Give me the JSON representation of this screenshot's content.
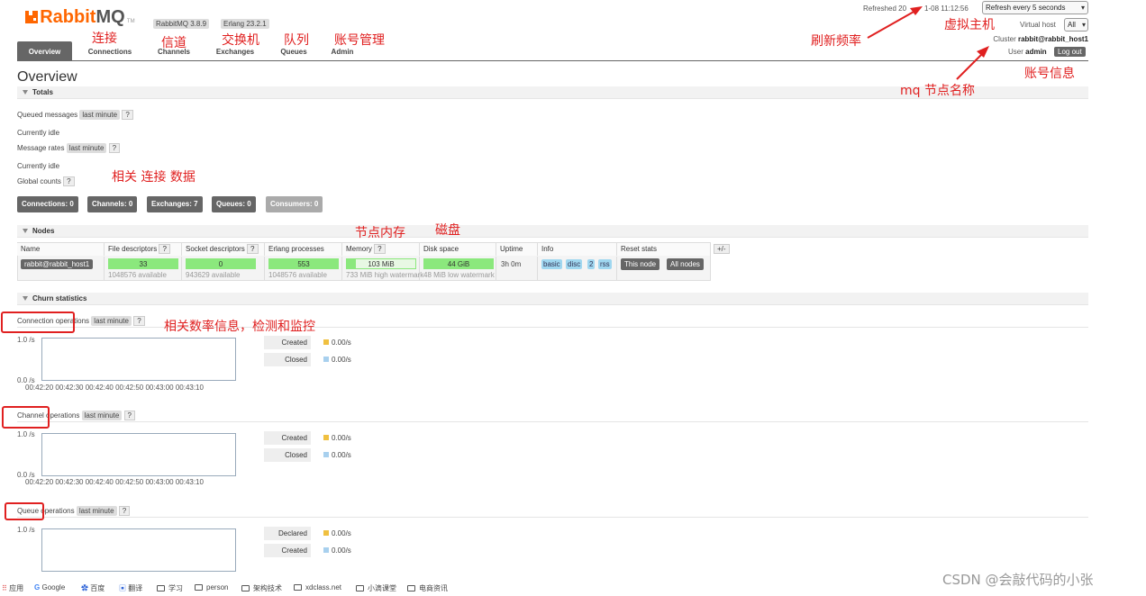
{
  "header": {
    "logo_prefix": "Rabbit",
    "logo_suffix": "MQ",
    "logo_tm": "TM",
    "version_badge": "RabbitMQ 3.8.9",
    "erlang_badge": "Erlang 23.2.1",
    "refreshed_label": "Refreshed 20",
    "refreshed_time": "1-08 11:12:56",
    "refresh_select": "Refresh every 5 seconds",
    "vhost_label": "Virtual host",
    "vhost_select": "All",
    "cluster_label": "Cluster",
    "cluster_name": "rabbit@rabbit_host1",
    "user_label": "User",
    "user_name": "admin",
    "logout_label": "Log out"
  },
  "tabs": [
    {
      "label": "Overview",
      "active": true
    },
    {
      "label": "Connections"
    },
    {
      "label": "Channels"
    },
    {
      "label": "Exchanges"
    },
    {
      "label": "Queues"
    },
    {
      "label": "Admin"
    }
  ],
  "page_title": "Overview",
  "totals": {
    "section_title": "Totals",
    "queued_label": "Queued messages",
    "queued_badge": "last minute",
    "help": "?",
    "idle1": "Currently idle",
    "rates_label": "Message rates",
    "rates_badge": "last minute",
    "idle2": "Currently idle",
    "global_label": "Global counts",
    "connections_btn": "Connections: 0",
    "channels_btn": "Channels: 0",
    "exchanges_btn": "Exchanges: 7",
    "queues_btn": "Queues: 0",
    "consumers_btn": "Consumers: 0"
  },
  "nodes": {
    "section_title": "Nodes",
    "headers": [
      "Name",
      "File descriptors",
      "Socket descriptors",
      "Erlang processes",
      "Memory",
      "Disk space",
      "Uptime",
      "Info",
      "Reset stats"
    ],
    "plus_minus": "+/-",
    "row": {
      "name": "rabbit@rabbit_host1",
      "fd_value": "33",
      "fd_avail": "1048576 available",
      "sd_value": "0",
      "sd_avail": "943629 available",
      "ep_value": "553",
      "ep_avail": "1048576 available",
      "mem_value": "103 MiB",
      "mem_sub": "733 MiB high watermark",
      "disk_value": "44 GiB",
      "disk_sub": "48 MiB low watermark",
      "uptime": "3h 0m",
      "info_tags": [
        "basic",
        "disc",
        "2",
        "rss"
      ],
      "reset_this": "This node",
      "reset_all": "All nodes"
    }
  },
  "churn": {
    "section_title": "Churn statistics",
    "help": "?",
    "badge": "last minute",
    "y_top": "1.0 /s",
    "y_bottom": "0.0 /s",
    "x_ticks": "00:42:20 00:42:30 00:42:40 00:42:50 00:43:00 00:43:10",
    "connection_label": "Connection operations",
    "connection_legend": [
      {
        "name": "Created",
        "value": "0.00/s"
      },
      {
        "name": "Closed",
        "value": "0.00/s"
      }
    ],
    "channel_label": "Channel operations",
    "channel_legend": [
      {
        "name": "Created",
        "value": "0.00/s"
      },
      {
        "name": "Closed",
        "value": "0.00/s"
      }
    ],
    "queue_label": "Queue operations",
    "queue_legend": [
      {
        "name": "Declared",
        "value": "0.00/s"
      },
      {
        "name": "Created",
        "value": "0.00/s"
      }
    ],
    "color_a": "#f0c040",
    "color_b": "#a8d0ee"
  },
  "annotations": {
    "connections": "连接",
    "channels": "信道",
    "exchanges": "交换机",
    "queues": "队列",
    "admin": "账号管理",
    "refresh": "刷新频率",
    "vhost": "虚拟主机",
    "account": "账号信息",
    "node_name": "mq 节点名称",
    "conn_data": "相关 连接 数据",
    "node_memory": "节点内存",
    "disk": "磁盘",
    "rates_info": "相关数率信息，检测和监控"
  },
  "bookmarks": [
    "应用",
    "Google",
    "百度",
    "翻译",
    "学习",
    "person",
    "架构技术",
    "xdclass.net",
    "小滴课堂",
    "电商资讯"
  ],
  "watermark": "CSDN @会敲代码的小张",
  "colors": {
    "brand": "#f60",
    "green": "#8be87d",
    "annotation": "#e02020"
  }
}
